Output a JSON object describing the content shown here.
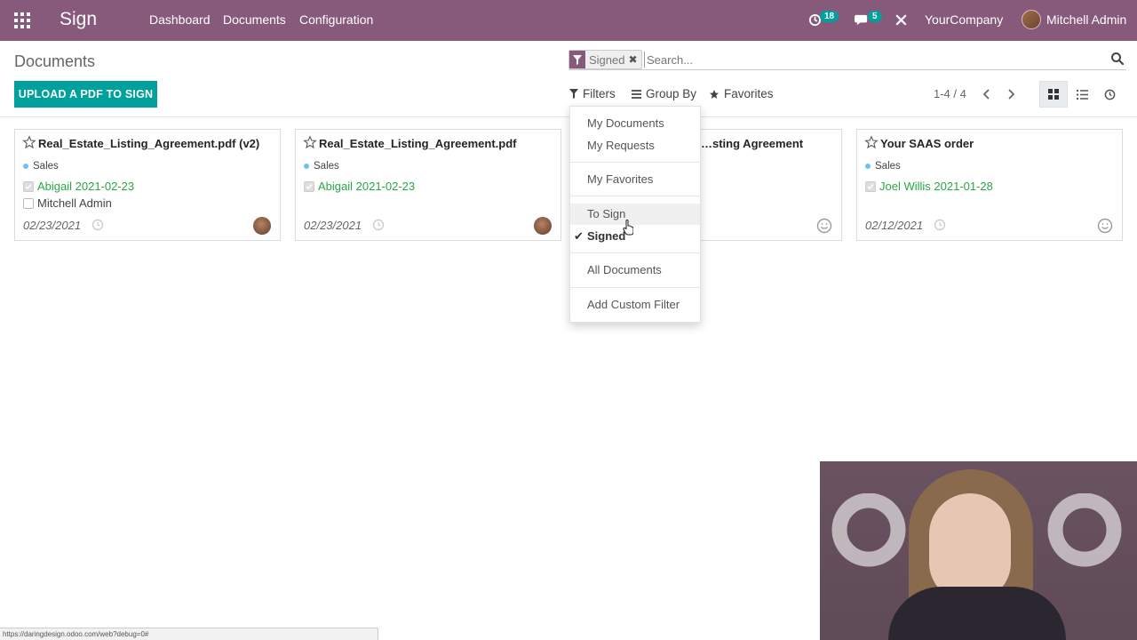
{
  "topbar": {
    "app_name": "Sign",
    "nav": [
      "Dashboard",
      "Documents",
      "Configuration"
    ],
    "activity_count": "18",
    "messages_count": "5",
    "company": "YourCompany",
    "user": "Mitchell Admin",
    "bg_color": "#875a7b"
  },
  "breadcrumb": "Documents",
  "upload_button": "UPLOAD A PDF TO SIGN",
  "search": {
    "facet": "Signed",
    "placeholder": "Search..."
  },
  "controls": {
    "filters": "Filters",
    "group_by": "Group By",
    "favorites": "Favorites",
    "pager": "1-4 / 4"
  },
  "cards": [
    {
      "title": "Real_Estate_Listing_Agreement.pdf (v2)",
      "tag": "Sales",
      "signers": [
        {
          "name": "Abigail 2021-02-23",
          "signed": true
        },
        {
          "name": "Mitchell Admin",
          "signed": false
        }
      ],
      "date": "02/23/2021",
      "avatar": "user-photo"
    },
    {
      "title": "Real_Estate_Listing_Agreement.pdf",
      "tag": "Sales",
      "signers": [
        {
          "name": "Abigail 2021-02-23",
          "signed": true
        }
      ],
      "date": "02/23/2021",
      "avatar": "user-photo"
    },
    {
      "title": "…sting Agreement",
      "avatar": "smiley"
    },
    {
      "title": "Your SAAS order",
      "tag": "Sales",
      "signers": [
        {
          "name": "Joel Willis 2021-01-28",
          "signed": true
        }
      ],
      "date": "02/12/2021",
      "avatar": "smiley"
    }
  ],
  "filters_menu": {
    "groups": [
      [
        "My Documents",
        "My Requests"
      ],
      [
        "My Favorites"
      ],
      [
        "To Sign",
        "Signed"
      ],
      [
        "All Documents"
      ],
      [
        "Add Custom Filter"
      ]
    ],
    "checked": "Signed",
    "hovered": "To Sign"
  },
  "status_bar": "https://daringdesign.odoo.com/web?debug=0#",
  "colors": {
    "primary": "#875a7b",
    "accent": "#00a09d",
    "signed_green": "#28a745"
  }
}
